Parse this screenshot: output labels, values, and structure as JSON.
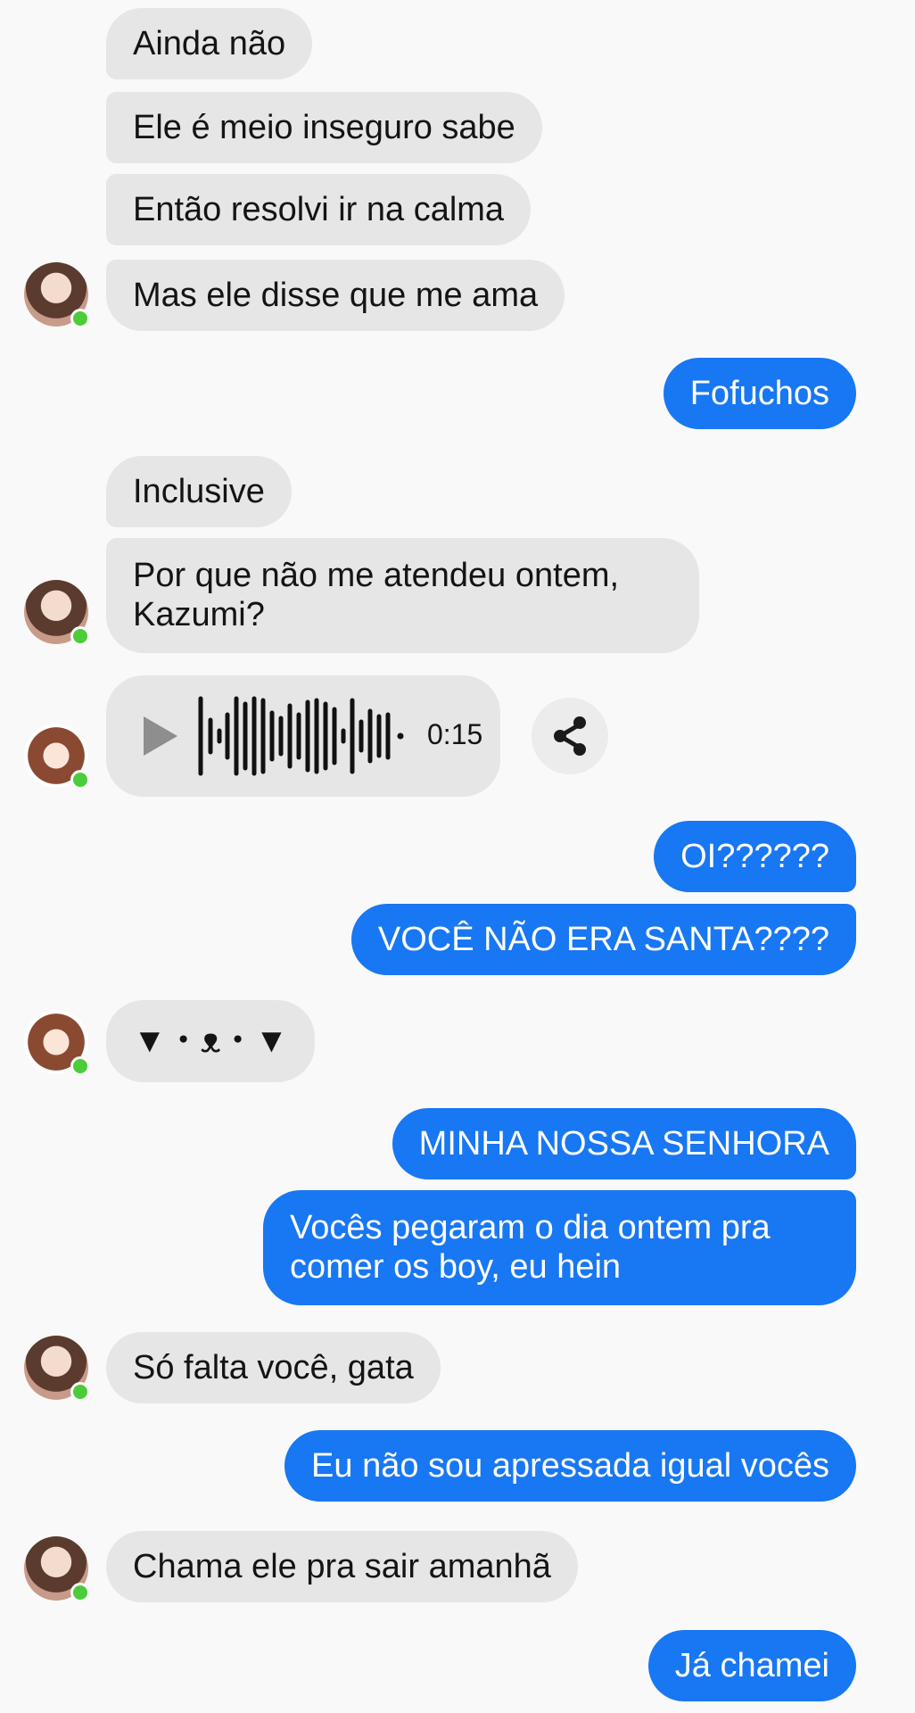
{
  "messages": {
    "m1": "Ainda não",
    "m2": "Ele é meio inseguro sabe",
    "m3": "Então resolvi ir na calma",
    "m4": "Mas ele disse que me ama",
    "m5": "Fofuchos",
    "m6": "Inclusive",
    "m7": "Por que não me atendeu ontem, Kazumi?",
    "m9": "OI??????",
    "m10": "VOCÊ NÃO ERA SANTA????",
    "m11": "▼・ᴥ・▼",
    "m12": "MINHA NOSSA SENHORA",
    "m13": "Vocês pegaram o dia ontem pra comer os boy, eu hein",
    "m14": "Só falta você, gata",
    "m15": "Eu não sou apressada igual vocês",
    "m16": "Chama ele pra sair amanhã",
    "m17": "Já chamei"
  },
  "audio": {
    "duration": "0:15"
  },
  "icons": {
    "play": "play-icon",
    "share": "share-icon",
    "online": "online-status-dot"
  },
  "colors": {
    "outgoing": "#1877f2",
    "incoming": "#e6e6e6",
    "online": "#4bcc3a"
  }
}
